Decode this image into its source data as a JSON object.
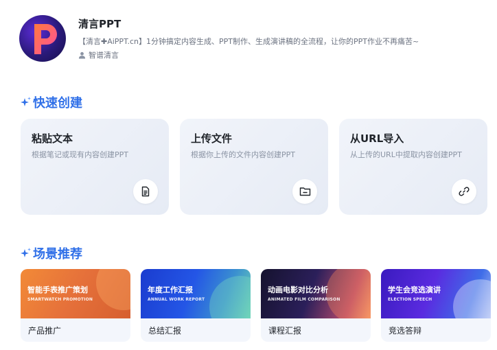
{
  "app": {
    "name": "清言PPT",
    "description": "【清言✚AiPPT.cn】1分钟搞定内容生成、PPT制作、生成演讲稿的全流程，让你的PPT作业不再痛苦~",
    "author": "智谱清言"
  },
  "quick_create": {
    "title": "快速创建",
    "cards": [
      {
        "title": "粘贴文本",
        "desc": "根据笔记或现有内容创建PPT",
        "icon": "document-icon"
      },
      {
        "title": "上传文件",
        "desc": "根据你上传的文件内容创建PPT",
        "icon": "folder-icon"
      },
      {
        "title": "从URL导入",
        "desc": "从上传的URL中提取内容创建PPT",
        "icon": "link-icon"
      }
    ]
  },
  "scenes": {
    "title": "场景推荐",
    "cards": [
      {
        "banner_title": "智能手表推广策划",
        "banner_sub": "SMARTWATCH PROMOTION",
        "label": "产品推广"
      },
      {
        "banner_title": "年度工作汇报",
        "banner_sub": "ANNUAL WORK REPORT",
        "label": "总结汇报"
      },
      {
        "banner_title": "动画电影对比分析",
        "banner_sub": "ANIMATED FILM COMPARISON",
        "label": "课程汇报"
      },
      {
        "banner_title": "学生会竞选演讲",
        "banner_sub": "ELECTION SPEECH",
        "label": "竞选答辩"
      }
    ]
  },
  "colors": {
    "accent": "#3070e8",
    "card_bg": "#eef2f9"
  }
}
